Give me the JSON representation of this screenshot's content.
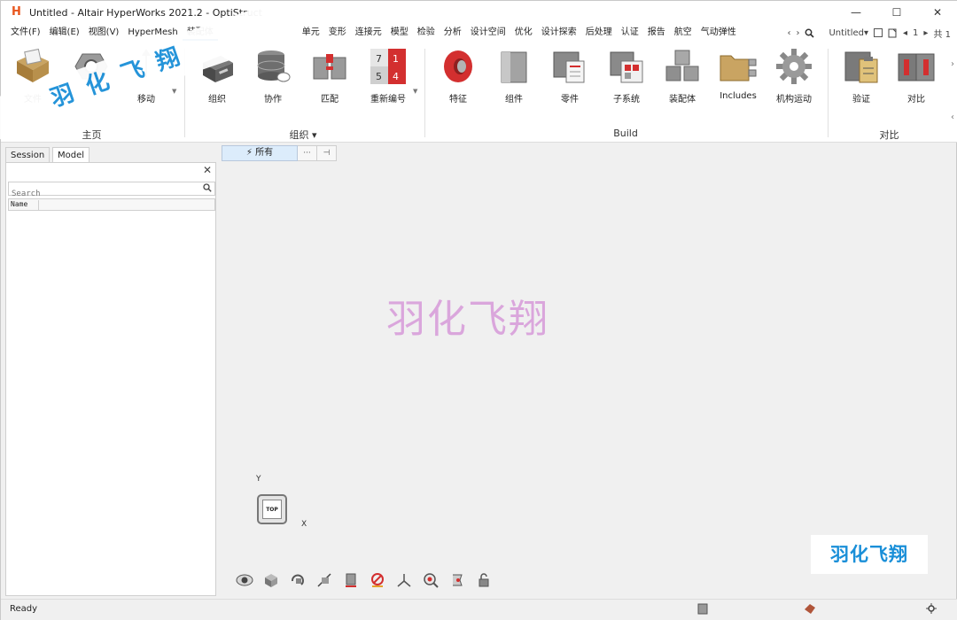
{
  "window": {
    "title": "Untitled - Altair HyperWorks 2021.2 - OptiStruct",
    "minimize": "—",
    "maximize": "☐",
    "close": "✕"
  },
  "menu": {
    "items": [
      "文件(F)",
      "编辑(E)",
      "视图(V)",
      "HyperMesh",
      "装配体",
      "",
      "单元",
      "变形",
      "连接元",
      "模型",
      "检验",
      "分析",
      "设计空间",
      "优化",
      "设计探索",
      "后处理",
      "认证",
      "报告",
      "航空",
      "气动弹性"
    ],
    "nav_prev": "‹",
    "nav_next": "›",
    "search_icon": "search-icon",
    "session_name": "Untitled▾",
    "page_prev": "◂",
    "page_info": "1",
    "page_next": "▸",
    "page_total": "共 1"
  },
  "ribbon": {
    "home": {
      "file": "文件",
      "move": "移动",
      "group": "主页"
    },
    "organize": {
      "group_label": "组织",
      "collab": "协作",
      "match": "匹配",
      "renumber": "重新编号",
      "group": "组织 ▾"
    },
    "build": {
      "feature": "特征",
      "component": "组件",
      "part": "零件",
      "subsystem": "子系统",
      "assembly": "装配体",
      "includes": "Includes",
      "mechanism": "机构运动",
      "group": "Build"
    },
    "compare": {
      "verify": "验证",
      "compare": "对比",
      "group": "对比"
    }
  },
  "side": {
    "tab_session": "Session",
    "tab_model": "Model",
    "search_placeholder": "Search",
    "col_name": "Name"
  },
  "filter": {
    "all": "⚡ 所有",
    "more": "···",
    "pin": "⊣"
  },
  "viewport": {
    "watermark": "羽化飞翔",
    "axis_y": "Y",
    "axis_x": "X",
    "cube_face": "TOP",
    "corner_watermark": "羽化飞翔"
  },
  "top_watermark": "羽化飞翔",
  "status": {
    "text": "Ready"
  },
  "colors": {
    "accent": "#2a76c6",
    "watermark_blue": "#1a8fd8",
    "watermark_pink": "#d79ad9",
    "ribbon_red": "#d32f2f"
  }
}
